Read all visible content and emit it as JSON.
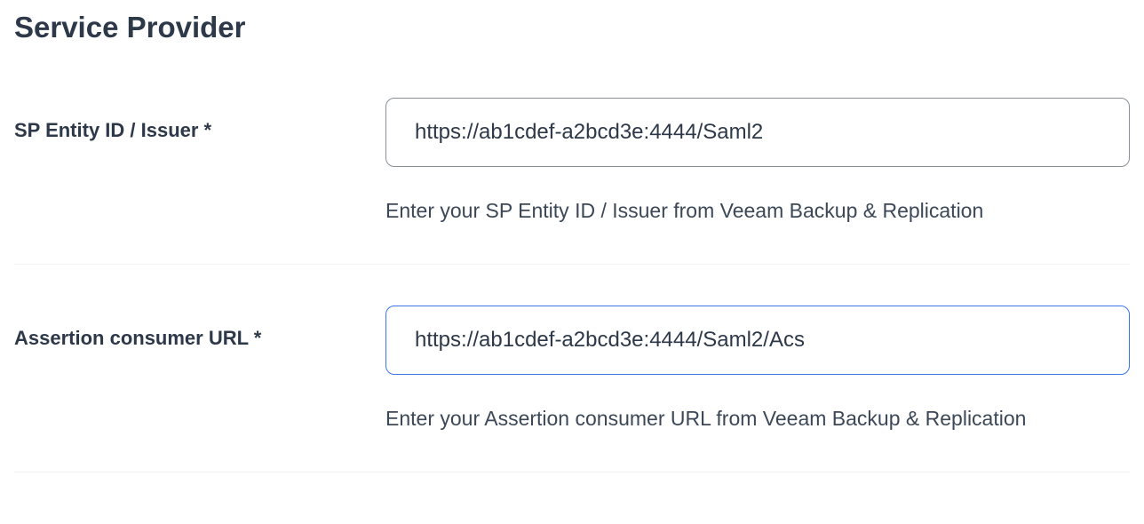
{
  "section": {
    "title": "Service Provider"
  },
  "fields": {
    "sp_entity_id": {
      "label": "SP Entity ID / Issuer *",
      "value": "https://ab1cdef-a2bcd3e:4444/Saml2",
      "help": "Enter your SP Entity ID / Issuer from Veeam Backup & Replication"
    },
    "assertion_consumer_url": {
      "label": "Assertion consumer URL *",
      "value": "https://ab1cdef-a2bcd3e:4444/Saml2/Acs",
      "help": "Enter your Assertion consumer URL from Veeam Backup & Replication"
    }
  }
}
